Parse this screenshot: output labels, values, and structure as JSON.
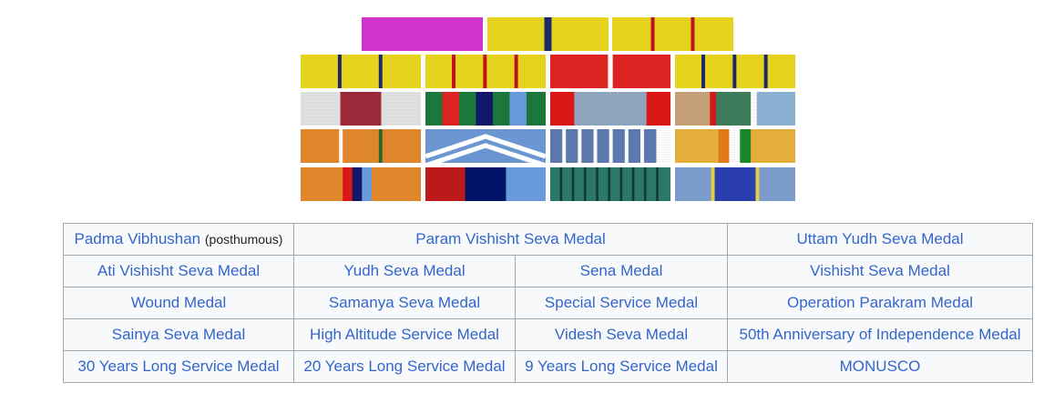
{
  "ribbons": [
    {
      "name": "ribbon-padma-vibhushan",
      "bands": [
        [
          "#d534d3",
          100
        ]
      ]
    },
    {
      "name": "ribbon-param-vishisht-seva-medal",
      "bands": [
        [
          "#ebd81e",
          47
        ],
        [
          "#1d2a6b",
          6
        ],
        [
          "#ebd81e",
          47
        ]
      ]
    },
    {
      "name": "ribbon-uttam-yudh-seva-medal",
      "bands": [
        [
          "#ebd81e",
          32
        ],
        [
          "#c2141d",
          3
        ],
        [
          "#ebd81e",
          30
        ],
        [
          "#c2141d",
          3
        ],
        [
          "#ebd81e",
          32
        ]
      ]
    },
    {
      "name": "ribbon-ati-vishisht-seva-medal",
      "bands": [
        [
          "#ebd81e",
          31
        ],
        [
          "#1d2a6b",
          3
        ],
        [
          "#ebd81e",
          31
        ],
        [
          "#1d2a6b",
          3
        ],
        [
          "#ebd81e",
          32
        ]
      ]
    },
    {
      "name": "ribbon-yudh-seva-medal",
      "bands": [
        [
          "#ebd81e",
          22
        ],
        [
          "#c2141d",
          3
        ],
        [
          "#ebd81e",
          23
        ],
        [
          "#c2141d",
          3
        ],
        [
          "#ebd81e",
          23
        ],
        [
          "#c2141d",
          3
        ],
        [
          "#ebd81e",
          23
        ]
      ]
    },
    {
      "name": "ribbon-sena-medal",
      "bands": [
        [
          "#e32424",
          48
        ],
        [
          "#ffffff",
          4
        ],
        [
          "#e32424",
          48
        ]
      ]
    },
    {
      "name": "ribbon-vishisht-seva-medal",
      "bands": [
        [
          "#ebd81e",
          22
        ],
        [
          "#1d2a6b",
          3
        ],
        [
          "#ebd81e",
          23
        ],
        [
          "#1d2a6b",
          3
        ],
        [
          "#ebd81e",
          23
        ],
        [
          "#1d2a6b",
          3
        ],
        [
          "#ebd81e",
          23
        ]
      ]
    },
    {
      "name": "ribbon-wound-medal",
      "bands": [
        [
          "#e4e4e4",
          33
        ],
        [
          "#9e2a3a",
          34
        ],
        [
          "#e4e4e4",
          33
        ]
      ]
    },
    {
      "name": "ribbon-samanya-seva-medal",
      "bands": [
        [
          "#1c7a3c",
          14
        ],
        [
          "#e32424",
          14
        ],
        [
          "#1c7a3c",
          14
        ],
        [
          "#12196c",
          14
        ],
        [
          "#1c7a3c",
          14
        ],
        [
          "#6a9ee0",
          14
        ],
        [
          "#1c7a3c",
          16
        ]
      ]
    },
    {
      "name": "ribbon-special-service-medal",
      "bands": [
        [
          "#e01818",
          20
        ],
        [
          "#93a9c4",
          60
        ],
        [
          "#e01818",
          20
        ]
      ]
    },
    {
      "name": "ribbon-operation-parakram-medal",
      "bands": [
        [
          "#c9a47a",
          29
        ],
        [
          "#d91b1b",
          5
        ],
        [
          "#3f7f5e",
          29
        ],
        [
          "#ffffff",
          5
        ],
        [
          "#8fb5d6",
          32
        ]
      ]
    },
    {
      "name": "ribbon-sainya-seva-medal",
      "bands": [
        [
          "#e48a2c",
          32
        ],
        [
          "#ffffff",
          3
        ],
        [
          "#e48a2c",
          30
        ],
        [
          "#2d6a2d",
          3
        ],
        [
          "#e48a2c",
          32
        ]
      ]
    },
    {
      "name": "ribbon-high-altitude-service-medal",
      "bands": [
        [
          "#6d9ad6",
          100
        ]
      ]
    },
    {
      "name": "ribbon-videsh-seva-medal",
      "bands": [
        [
          "#5e7cb1",
          10
        ],
        [
          "#ffffff",
          3
        ],
        [
          "#5e7cb1",
          10
        ],
        [
          "#ffffff",
          3
        ],
        [
          "#5e7cb1",
          10
        ],
        [
          "#ffffff",
          3
        ],
        [
          "#5e7cb1",
          10
        ],
        [
          "#ffffff",
          3
        ],
        [
          "#5e7cb1",
          10
        ],
        [
          "#ffffff",
          3
        ],
        [
          "#5e7cb1",
          10
        ],
        [
          "#ffffff",
          3
        ],
        [
          "#5e7cb1",
          10
        ]
      ]
    },
    {
      "name": "ribbon-50th-anniversary-independence-medal",
      "bands": [
        [
          "#e9b33d",
          36
        ],
        [
          "#e57d1e",
          9
        ],
        [
          "#ffffff",
          9
        ],
        [
          "#1b8a2b",
          9
        ],
        [
          "#e9b33d",
          37
        ]
      ]
    },
    {
      "name": "ribbon-30-years-long-service-medal",
      "bands": [
        [
          "#e48a2c",
          35
        ],
        [
          "#e01818",
          8
        ],
        [
          "#12196c",
          8
        ],
        [
          "#6a9ee0",
          8
        ],
        [
          "#e48a2c",
          41
        ]
      ]
    },
    {
      "name": "ribbon-20-years-long-service-medal",
      "bands": [
        [
          "#c01a1a",
          33
        ],
        [
          "#00156b",
          34
        ],
        [
          "#6a9ee0",
          33
        ]
      ]
    },
    {
      "name": "ribbon-9-years-long-service-medal",
      "bands": [
        [
          "#2b7a6c",
          8
        ],
        [
          "#123a36",
          2
        ],
        [
          "#2b7a6c",
          8
        ],
        [
          "#123a36",
          2
        ],
        [
          "#2b7a6c",
          8
        ],
        [
          "#123a36",
          2
        ],
        [
          "#2b7a6c",
          8
        ],
        [
          "#123a36",
          2
        ],
        [
          "#2b7a6c",
          8
        ],
        [
          "#123a36",
          2
        ],
        [
          "#2b7a6c",
          8
        ],
        [
          "#123a36",
          2
        ],
        [
          "#2b7a6c",
          8
        ],
        [
          "#123a36",
          2
        ],
        [
          "#2b7a6c",
          8
        ],
        [
          "#123a36",
          2
        ],
        [
          "#2b7a6c",
          8
        ],
        [
          "#123a36",
          2
        ],
        [
          "#2b7a6c",
          10
        ]
      ]
    },
    {
      "name": "ribbon-monusco",
      "bands": [
        [
          "#7d9fd0",
          30
        ],
        [
          "#e8d34a",
          3
        ],
        [
          "#2b3fb3",
          34
        ],
        [
          "#e8d34a",
          3
        ],
        [
          "#7d9fd0",
          30
        ]
      ]
    }
  ],
  "table": {
    "rows": [
      [
        {
          "text": "Padma Vibhushan",
          "note": "(posthumous)"
        },
        {
          "text": "Param Vishisht Seva Medal",
          "colspan": 2
        },
        {
          "text": "Uttam Yudh Seva Medal"
        }
      ],
      [
        {
          "text": "Ati Vishisht Seva Medal"
        },
        {
          "text": "Yudh Seva Medal"
        },
        {
          "text": "Sena Medal"
        },
        {
          "text": "Vishisht Seva Medal"
        }
      ],
      [
        {
          "text": "Wound Medal"
        },
        {
          "text": "Samanya Seva Medal"
        },
        {
          "text": "Special Service Medal"
        },
        {
          "text": "Operation Parakram Medal"
        }
      ],
      [
        {
          "text": "Sainya Seva Medal"
        },
        {
          "text": "High Altitude Service Medal"
        },
        {
          "text": "Videsh Seva Medal"
        },
        {
          "text": "50th Anniversary of Independence Medal"
        }
      ],
      [
        {
          "text": "30 Years Long Service Medal"
        },
        {
          "text": "20 Years Long Service Medal"
        },
        {
          "text": "9 Years Long Service Medal"
        },
        {
          "text": "MONUSCO"
        }
      ]
    ]
  }
}
